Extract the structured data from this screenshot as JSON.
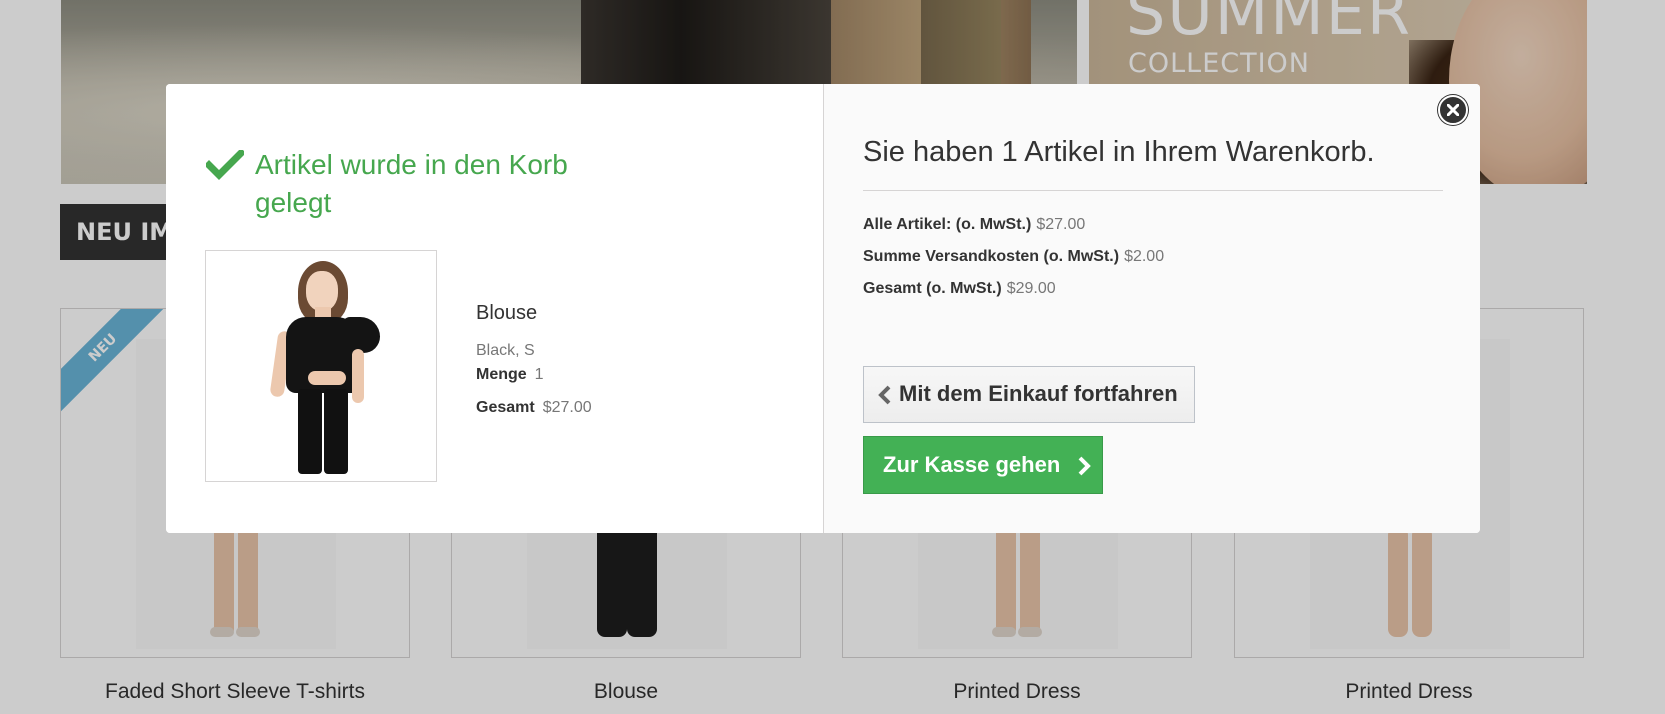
{
  "banner": {
    "summer_text": "SUMMER",
    "collection_text": "COLLECTION"
  },
  "section": {
    "heading": "NEU IM"
  },
  "products": [
    {
      "name": "Faded Short Sleeve T-shirts",
      "badge": "NEU"
    },
    {
      "name": "Blouse"
    },
    {
      "name": "Printed Dress"
    },
    {
      "name": "Printed Dress"
    }
  ],
  "modal": {
    "added_message": "Artikel wurde in den Korb gelegt",
    "item": {
      "name": "Blouse",
      "attributes": "Black, S",
      "quantity_label": "Menge",
      "quantity_value": "1",
      "total_label": "Gesamt",
      "total_value": "$27.00"
    },
    "cart_heading": "Sie haben 1 Artikel in Ihrem Warenkorb.",
    "summary": {
      "products_label": "Alle Artikel: (o. MwSt.)",
      "products_value": "$27.00",
      "shipping_label": "Summe Versandkosten (o. MwSt.)",
      "shipping_value": "$2.00",
      "total_label": "Gesamt (o. MwSt.)",
      "total_value": "$29.00"
    },
    "continue_label": "Mit dem Einkauf fortfahren",
    "checkout_label": "Zur Kasse gehen",
    "icons": {
      "success": "check-icon",
      "close": "close-icon",
      "continue": "chevron-left-icon",
      "checkout": "chevron-right-icon"
    }
  },
  "colors": {
    "success_green": "#46a74e",
    "checkout_green": "#43b155",
    "dark": "#333333",
    "ribbon_blue": "#6ab4d7"
  }
}
